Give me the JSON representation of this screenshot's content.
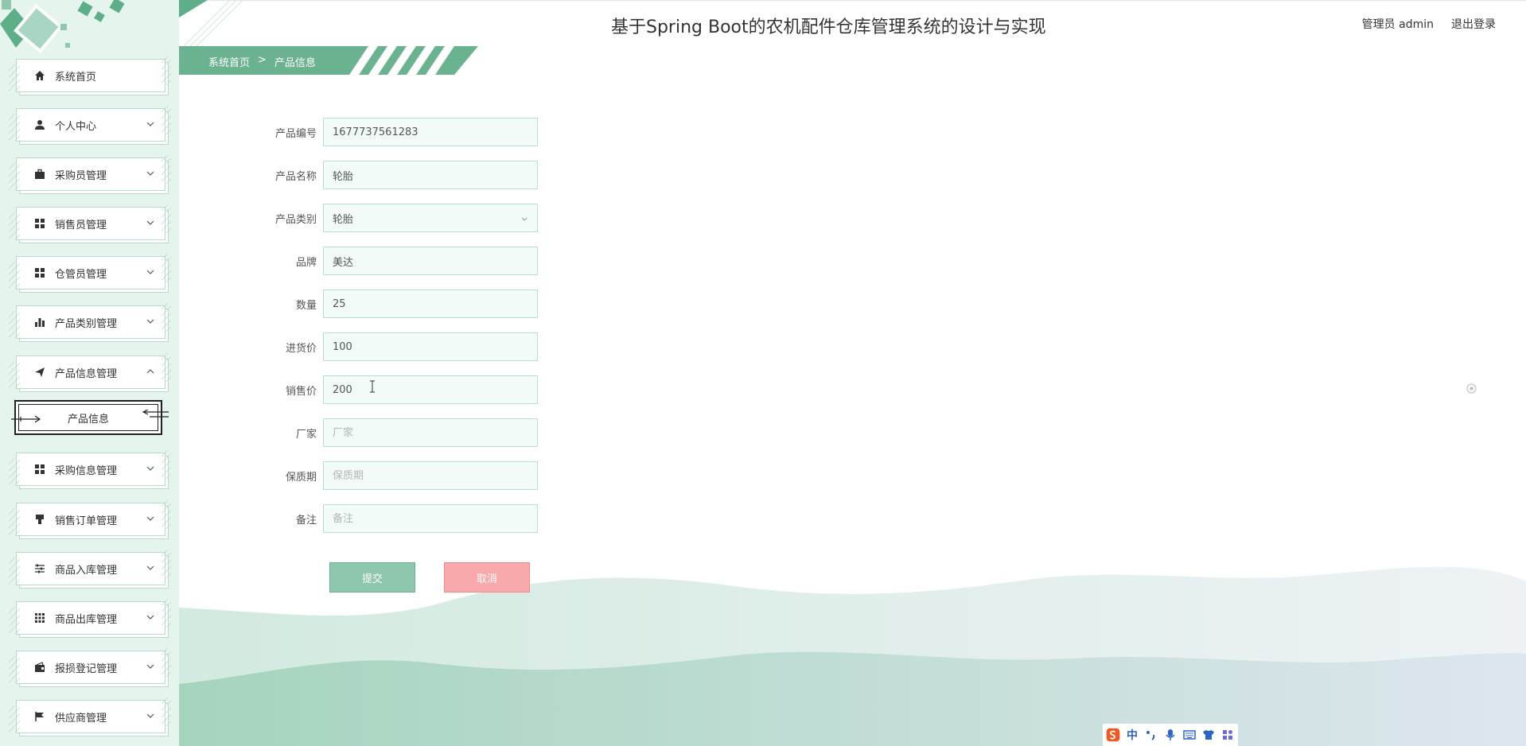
{
  "header": {
    "title": "基于Spring Boot的农机配件仓库管理系统的设计与实现",
    "user": "管理员 admin",
    "logout": "退出登录"
  },
  "breadcrumb": {
    "home": "系统首页",
    "separator": ">",
    "current": "产品信息"
  },
  "sidebar": {
    "items": [
      {
        "label": "系统首页",
        "icon": "home-icon"
      },
      {
        "label": "个人中心",
        "icon": "user-icon"
      },
      {
        "label": "采购员管理",
        "icon": "briefcase-icon"
      },
      {
        "label": "销售员管理",
        "icon": "grid-icon"
      },
      {
        "label": "仓管员管理",
        "icon": "grid-icon"
      },
      {
        "label": "产品类别管理",
        "icon": "bar-chart-icon"
      },
      {
        "label": "产品信息管理",
        "icon": "send-icon"
      },
      {
        "label": "采购信息管理",
        "icon": "grid-icon"
      },
      {
        "label": "销售订单管理",
        "icon": "stamp-icon"
      },
      {
        "label": "商品入库管理",
        "icon": "sliders-icon"
      },
      {
        "label": "商品出库管理",
        "icon": "apps-icon"
      },
      {
        "label": "报损登记管理",
        "icon": "wallet-icon"
      },
      {
        "label": "供应商管理",
        "icon": "flag-icon"
      }
    ],
    "sub_item": "产品信息"
  },
  "form": {
    "fields": [
      {
        "label": "产品编号",
        "value": "1677737561283",
        "placeholder": ""
      },
      {
        "label": "产品名称",
        "value": "轮胎",
        "placeholder": ""
      },
      {
        "label": "产品类别",
        "value": "轮胎",
        "placeholder": ""
      },
      {
        "label": "品牌",
        "value": "美达",
        "placeholder": ""
      },
      {
        "label": "数量",
        "value": "25",
        "placeholder": ""
      },
      {
        "label": "进货价",
        "value": "100",
        "placeholder": ""
      },
      {
        "label": "销售价",
        "value": "200",
        "placeholder": ""
      },
      {
        "label": "厂家",
        "value": "",
        "placeholder": "厂家"
      },
      {
        "label": "保质期",
        "value": "",
        "placeholder": "保质期"
      },
      {
        "label": "备注",
        "value": "",
        "placeholder": "备注"
      }
    ],
    "submit": "提交",
    "cancel": "取消"
  },
  "ime": {
    "lang": "中",
    "items": [
      "sogou-icon",
      "chinese-mode",
      "punctuation-icon",
      "mic-icon",
      "keyboard-icon",
      "skin-icon",
      "toolbox-icon"
    ]
  },
  "colors": {
    "accent": "#5fae8a",
    "sidebar_bg": "#e6f4ee",
    "field_bg": "#f2fbf7",
    "submit": "#8ec7ad",
    "cancel": "#f8a9ab"
  }
}
